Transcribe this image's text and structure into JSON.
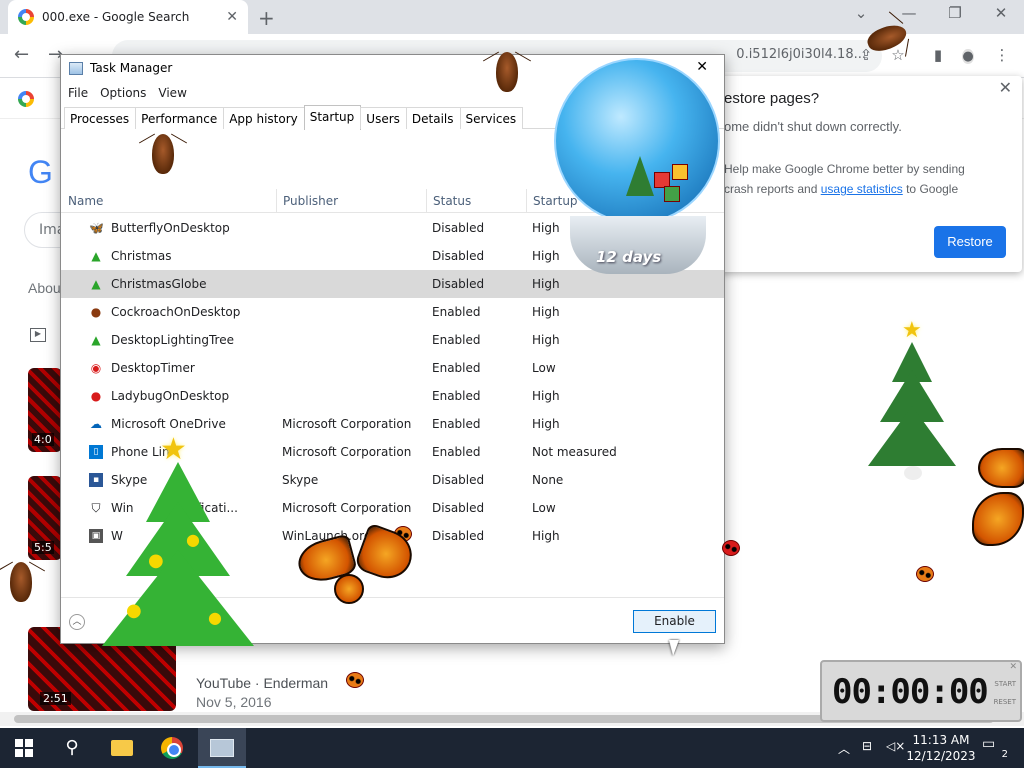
{
  "browser": {
    "tab_title": "000.exe - Google Search",
    "omnibox_text": "0.i512l6j0i30l4.18...",
    "window_controls": [
      "chevron-down-icon",
      "minimize-icon",
      "restore-icon",
      "close-icon"
    ]
  },
  "google_page": {
    "logo_fragment": "G",
    "search_fragment": "Ima",
    "about_fragment": "Abou",
    "thumb_durations": [
      "4:0",
      "5:5"
    ],
    "video": {
      "duration": "2:51",
      "source": "YouTube · Enderman",
      "date": "Nov 5, 2016"
    }
  },
  "restore_popup": {
    "title": "estore pages?",
    "subtitle": "ome didn't shut down correctly.",
    "checkbox_text_prefix": "Help make Google Chrome better by sending crash reports and ",
    "link_text": "usage statistics",
    "checkbox_text_suffix": " to Google",
    "button_label": "Restore"
  },
  "task_manager": {
    "title": "Task Manager",
    "menu": [
      "File",
      "Options",
      "View"
    ],
    "tabs": [
      "Processes",
      "Performance",
      "App history",
      "Startup",
      "Users",
      "Details",
      "Services"
    ],
    "active_tab": "Startup",
    "columns": [
      "Name",
      "Publisher",
      "Status",
      "Startup"
    ],
    "rows": [
      {
        "name": "ButterflyOnDesktop",
        "publisher": "",
        "status": "Disabled",
        "impact": "High",
        "icon": "butterfly-icon"
      },
      {
        "name": "Christmas",
        "publisher": "",
        "status": "Disabled",
        "impact": "High",
        "icon": "christmas-tree-icon"
      },
      {
        "name": "ChristmasGlobe",
        "publisher": "",
        "status": "Disabled",
        "impact": "High",
        "icon": "snow-globe-icon",
        "selected": true
      },
      {
        "name": "CockroachOnDesktop",
        "publisher": "",
        "status": "Enabled",
        "impact": "High",
        "icon": "cockroach-icon"
      },
      {
        "name": "DesktopLightingTree",
        "publisher": "",
        "status": "Enabled",
        "impact": "High",
        "icon": "lighting-tree-icon"
      },
      {
        "name": "DesktopTimer",
        "publisher": "",
        "status": "Enabled",
        "impact": "Low",
        "icon": "timer-icon"
      },
      {
        "name": "LadybugOnDesktop",
        "publisher": "",
        "status": "Enabled",
        "impact": "High",
        "icon": "ladybug-icon"
      },
      {
        "name": "Microsoft OneDrive",
        "publisher": "Microsoft Corporation",
        "status": "Enabled",
        "impact": "High",
        "icon": "onedrive-icon"
      },
      {
        "name": "Phone Lin",
        "publisher": "Microsoft Corporation",
        "status": "Enabled",
        "impact": "Not measured",
        "icon": "phone-link-icon"
      },
      {
        "name": "Skype",
        "publisher": "Skype",
        "status": "Disabled",
        "impact": "None",
        "icon": "skype-icon"
      },
      {
        "name": "Win",
        "publisher": "Microsoft Corporation",
        "status": "Disabled",
        "impact": "Low",
        "icon": "shield-icon",
        "name_tail": "otificati..."
      },
      {
        "name": "W",
        "publisher": "WinLaunch.org",
        "status": "Disabled",
        "impact": "High",
        "icon": "winlaunch-icon"
      }
    ],
    "enable_button": "Enable"
  },
  "desktop_toys": {
    "globe_label": "12 days",
    "timer_display": "00:00:00",
    "timer_labels": [
      "START",
      "RESET"
    ]
  },
  "taskbar": {
    "time": "11:13 AM",
    "date": "12/12/2023",
    "notification_count": "2",
    "apps": [
      "start-icon",
      "search-icon",
      "file-explorer-icon",
      "chrome-icon",
      "task-manager-icon"
    ]
  },
  "colors": {
    "chrome_blue": "#1a73e8",
    "taskbar": "#1c2533",
    "selected_row": "#d9d9d9"
  }
}
